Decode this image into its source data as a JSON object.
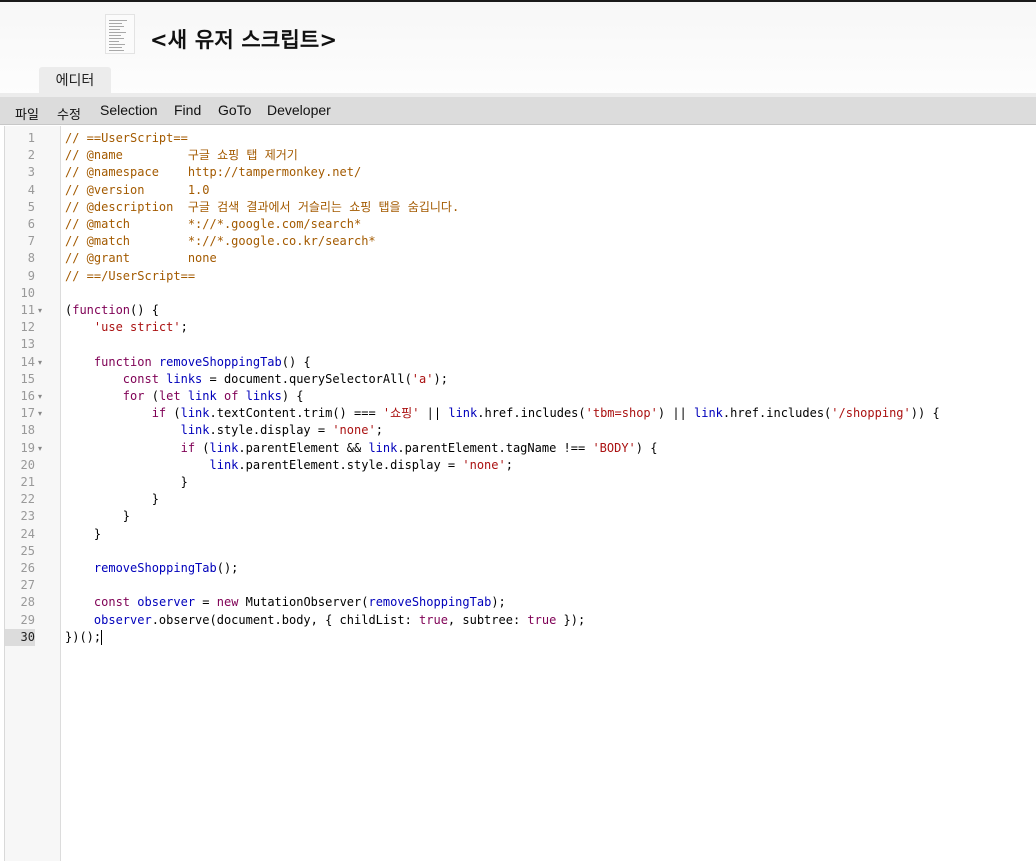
{
  "header": {
    "title": "<새 유저 스크립트>"
  },
  "tabs": [
    {
      "label": "에디터"
    }
  ],
  "menu": {
    "items": [
      {
        "label": "파일"
      },
      {
        "label": "수정"
      },
      {
        "label": "Selection"
      },
      {
        "label": "Find"
      },
      {
        "label": "GoTo"
      },
      {
        "label": "Developer"
      }
    ]
  },
  "editor": {
    "active_line": "30",
    "line_numbers": [
      "1",
      "2",
      "3",
      "4",
      "5",
      "6",
      "7",
      "8",
      "9",
      "10",
      "11",
      "12",
      "13",
      "14",
      "15",
      "16",
      "17",
      "18",
      "19",
      "20",
      "21",
      "22",
      "23",
      "24",
      "25",
      "26",
      "27",
      "28",
      "29",
      "30"
    ],
    "lines": [
      "// ==UserScript==",
      "// @name         구글 쇼핑 탭 제거기",
      "// @namespace    http://tampermonkey.net/",
      "// @version      1.0",
      "// @description  구글 검색 결과에서 거슬리는 쇼핑 탭을 숨깁니다.",
      "// @match        *://*.google.com/search*",
      "// @match        *://*.google.co.kr/search*",
      "// @grant        none",
      "// ==/UserScript==",
      "",
      "(function() {",
      "    'use strict';",
      "",
      "    function removeShoppingTab() {",
      "        const links = document.querySelectorAll('a');",
      "        for (let link of links) {",
      "            if (link.textContent.trim() === '쇼핑' || link.href.includes('tbm=shop') || link.href.includes('/shopping')) {",
      "                link.style.display = 'none';",
      "                if (link.parentElement && link.parentElement.tagName !== 'BODY') {",
      "                    link.parentElement.style.display = 'none';",
      "                }",
      "            }",
      "        }",
      "    }",
      "",
      "    removeShoppingTab();",
      "",
      "    const observer = new MutationObserver(removeShoppingTab);",
      "    observer.observe(document.body, { childList: true, subtree: true });",
      "})();"
    ]
  }
}
